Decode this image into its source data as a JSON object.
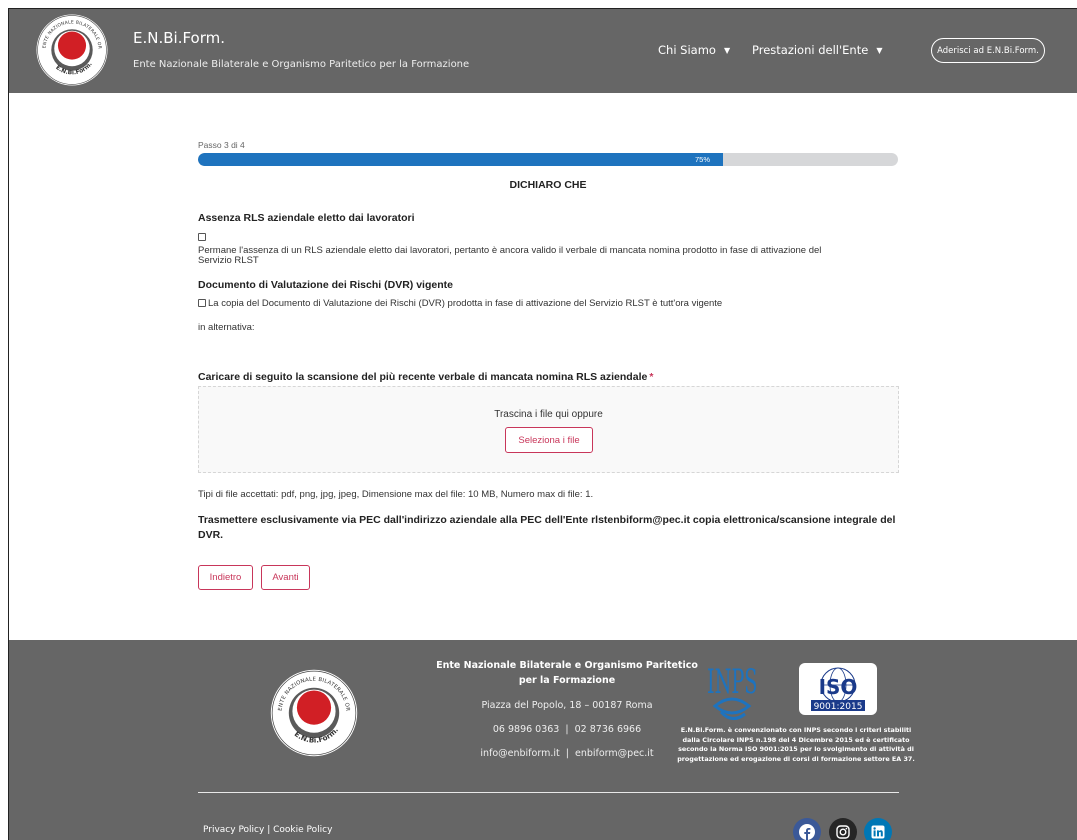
{
  "header": {
    "brand_title": "E.N.Bi.Form.",
    "brand_subtitle": "Ente Nazionale Bilaterale e Organismo Paritetico per la Formazione",
    "logo_text": "ENTE NAZIONALE BILATERALE ORGANISMO PARITETICO",
    "logo_name": "E.N.Bi.Form.",
    "nav": [
      {
        "label": "Chi Siamo",
        "caret": "▼"
      },
      {
        "label": "Prestazioni dell'Ente",
        "caret": "▼"
      }
    ],
    "join_button": "Aderisci ad E.N.Bi.Form."
  },
  "form": {
    "step_label": "Passo 3 di 4",
    "progress_percent": 75,
    "progress_label": "75%",
    "section_title": "DICHIARO CHE",
    "rls_heading": "Assenza RLS aziendale eletto dai lavoratori",
    "rls_text_1": "Permane l'assenza di un RLS aziendale eletto dai lavoratori, pertanto è ancora valido il verbale di mancata nomina prodotto in fase di attivazione del",
    "rls_text_2": "Servizio RLST",
    "dvr_heading": "Documento di Valutazione dei Rischi (DVR) vigente",
    "dvr_text": "La copia del Documento di Valutazione dei Rischi (DVR) prodotta in fase di attivazione del Servizio RLST è tutt'ora vigente",
    "alternative": "in alternativa:",
    "upload_heading": "Caricare di seguito la scansione del più recente verbale di mancata nomina RLS aziendale",
    "required_mark": "*",
    "drop_text": "Trascina i file qui oppure",
    "select_files": "Seleziona i file",
    "file_info": "Tipi di file accettati: pdf, png, jpg, jpeg, Dimensione max del file: 10 MB, Numero max di file: 1.",
    "pec_text_1": "Trasmettere esclusivamente via PEC dall'indirizzo aziendale alla PEC dell'Ente rlstenbiform@pec.it copia elettronica/scansione integrale del",
    "pec_text_2": "DVR.",
    "back_button": "Indietro",
    "next_button": "Avanti"
  },
  "footer": {
    "org_name_1": "Ente Nazionale Bilaterale e Organismo Paritetico",
    "org_name_2": "per la Formazione",
    "address": "Piazza del Popolo, 18 – 00187 Roma",
    "phones": "06 9896 0363  |  02 8736 6966",
    "emails": "info@enbiform.it  |  enbiform@pec.it",
    "inps_label": "INPS",
    "iso_label": "ISO",
    "iso_number": "9001:2015",
    "note_lines": [
      "E.N.Bi.Form. è convenzionato con INPS secondo i criteri stabiliti",
      "dalla Circolare INPS n.198 del 4 Dicembre 2015 ed è certificato",
      "secondo la Norma ISO 9001:2015 per lo svolgimento di attività di",
      "progettazione ed erogazione di corsi di formazione settore EA 37."
    ],
    "privacy_link": "Privacy Policy",
    "link_separator": " | ",
    "cookie_link": "Cookie Policy",
    "social": {
      "facebook_color": "#3b5998",
      "instagram_color": "#262626",
      "linkedin_color": "#0077b5"
    }
  },
  "colors": {
    "header_bg": "#666666",
    "progress_fill": "#1e73be",
    "accent": "#c8365a",
    "logo_red": "#d11f25"
  }
}
